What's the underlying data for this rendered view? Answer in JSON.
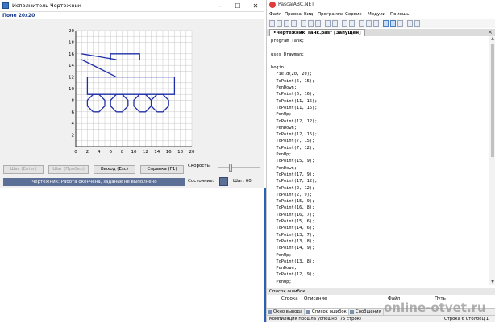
{
  "left_window": {
    "title": "Исполнитель Чертежник",
    "field_label": "Поле 20x20",
    "buttons": {
      "step": "Шаг (Enter)",
      "step_over": "Шаг (Пробел)",
      "exit": "Выход (Esc)",
      "help": "Справка (F1)"
    },
    "status": "Чертежник: Работа окончена, задание не выполнено",
    "speed_label": "Скорость:",
    "state_label": "Состояние:",
    "step_count": "Шаг: 60",
    "speed_level": 0.3
  },
  "drawing": {
    "grid_size": 20,
    "x_ticks": [
      "0",
      "2",
      "4",
      "6",
      "8",
      "10",
      "12",
      "14",
      "16",
      "18",
      "20"
    ],
    "y_ticks": [
      "0",
      "2",
      "4",
      "6",
      "8",
      "10",
      "12",
      "14",
      "16",
      "18",
      "20"
    ],
    "stroke_color": "#1f2fa8",
    "grid_color": "#c7c7c7",
    "polylines": [
      [
        [
          6,
          15
        ],
        [
          6,
          16
        ],
        [
          11,
          16
        ],
        [
          11,
          15
        ]
      ],
      [
        [
          2,
          12
        ],
        [
          2,
          9
        ],
        [
          17,
          9
        ],
        [
          17,
          12
        ],
        [
          2,
          12
        ]
      ],
      [
        [
          1,
          15
        ],
        [
          7,
          12
        ]
      ],
      [
        [
          7,
          15
        ],
        [
          1,
          16
        ]
      ],
      [
        [
          3,
          6
        ],
        [
          4,
          6
        ],
        [
          5,
          7
        ],
        [
          5,
          8
        ],
        [
          4,
          9
        ],
        [
          3,
          9
        ],
        [
          2,
          8
        ],
        [
          2,
          7
        ],
        [
          3,
          6
        ]
      ],
      [
        [
          7,
          6
        ],
        [
          8,
          6
        ],
        [
          9,
          7
        ],
        [
          9,
          8
        ],
        [
          8,
          9
        ],
        [
          7,
          9
        ],
        [
          6,
          8
        ],
        [
          6,
          7
        ],
        [
          7,
          6
        ]
      ],
      [
        [
          11,
          6
        ],
        [
          12,
          6
        ],
        [
          13,
          7
        ],
        [
          13,
          8
        ],
        [
          12,
          9
        ],
        [
          11,
          9
        ],
        [
          10,
          8
        ],
        [
          10,
          7
        ],
        [
          11,
          6
        ]
      ],
      [
        [
          14,
          6
        ],
        [
          15,
          6
        ],
        [
          16,
          7
        ],
        [
          16,
          8
        ],
        [
          15,
          9
        ],
        [
          14,
          9
        ],
        [
          13,
          8
        ],
        [
          13,
          7
        ],
        [
          14,
          6
        ]
      ]
    ]
  },
  "right_window": {
    "title": "PascalABC.NET",
    "menu": [
      "Файл",
      "Правка",
      "Вид",
      "Программа",
      "Сервис",
      "Модули",
      "Помощь"
    ],
    "tab_label": "•Чертежник_Танк.pas* [Запущен]",
    "code_lines": [
      "program Tank;",
      "",
      "uses Drawman;",
      "",
      "begin",
      "  Field(20, 20);",
      "  ToPoint(6, 15);",
      "  PenDown;",
      "  ToPoint(6, 16);",
      "  ToPoint(11, 16);",
      "  ToPoint(11, 15);",
      "  PenUp;",
      "  ToPoint(12, 12);",
      "  PenDown;",
      "  ToPoint(12, 15);",
      "  ToPoint(7, 15);",
      "  ToPoint(7, 12);",
      "  PenUp;",
      "  ToPoint(15, 9);",
      "  PenDown;",
      "  ToPoint(17, 9);",
      "  ToPoint(17, 12);",
      "  ToPoint(2, 12);",
      "  ToPoint(2, 9);",
      "  ToPoint(15, 9);",
      "  ToPoint(16, 8);",
      "  ToPoint(16, 7);",
      "  ToPoint(15, 6);",
      "  ToPoint(14, 6);",
      "  ToPoint(13, 7);",
      "  ToPoint(13, 8);",
      "  ToPoint(14, 9);",
      "  PenUp;",
      "  ToPoint(13, 8);",
      "  PenDown;",
      "  ToPoint(12, 9);",
      "  PenUp;",
      "  ToPoint(11, 9);",
      "  PenDown;"
    ],
    "errors_title": "Список ошибок",
    "error_columns": [
      "Строка",
      "Описание",
      "Файл",
      "Путь"
    ],
    "bottom_tabs": [
      "Окно вывода",
      "Список ошибок",
      "Сообщения"
    ],
    "status_message": "Компиляция прошла успешно (75 строк)",
    "status_position": "Строка 6  Столбец 1"
  },
  "watermark": "online-otvet.ru"
}
